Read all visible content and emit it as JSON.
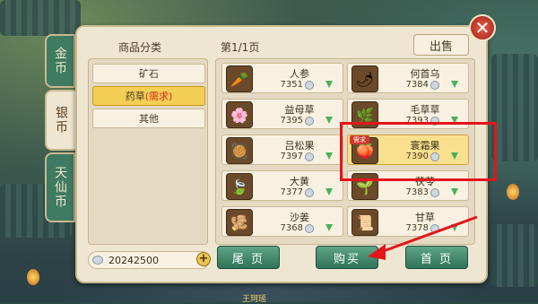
{
  "close_label": "✕",
  "vertical_tabs": [
    {
      "label": "金币",
      "active": false
    },
    {
      "label": "银币",
      "active": true
    },
    {
      "label": "天仙币",
      "active": false
    }
  ],
  "header": {
    "category_title": "商品分类",
    "page_label": "第1/1页",
    "sell_label": "出售"
  },
  "categories": [
    {
      "label": "矿石",
      "req": "",
      "selected": false
    },
    {
      "label": "药草",
      "req": "(需求)",
      "selected": true
    },
    {
      "label": "其他",
      "req": "",
      "selected": false
    }
  ],
  "items": [
    {
      "name": "人参",
      "price": "7351",
      "icon": "ginseng-icon",
      "glyph": "🥕",
      "tag": "",
      "selected": false
    },
    {
      "name": "何首乌",
      "price": "7384",
      "icon": "fleeceflower-icon",
      "glyph": "🌶",
      "tag": "",
      "selected": false
    },
    {
      "name": "益母草",
      "price": "7395",
      "icon": "motherwort-icon",
      "glyph": "🌸",
      "tag": "",
      "selected": false
    },
    {
      "name": "毛草草",
      "price": "7393",
      "icon": "grass-icon",
      "glyph": "🌿",
      "tag": "",
      "selected": false
    },
    {
      "name": "吕松果",
      "price": "7397",
      "icon": "pine-nut-icon",
      "glyph": "🥘",
      "tag": "",
      "selected": false
    },
    {
      "name": "寰霜果",
      "price": "7390",
      "icon": "frost-fruit-icon",
      "glyph": "🍑",
      "tag": "需求",
      "selected": true
    },
    {
      "name": "大黄",
      "price": "7377",
      "icon": "rhubarb-icon",
      "glyph": "🍃",
      "tag": "",
      "selected": false
    },
    {
      "name": "茯苓",
      "price": "7383",
      "icon": "poria-icon",
      "glyph": "🌱",
      "tag": "",
      "selected": false
    },
    {
      "name": "沙姜",
      "price": "7368",
      "icon": "ginger-icon",
      "glyph": "🫚",
      "tag": "",
      "selected": false
    },
    {
      "name": "甘草",
      "price": "7378",
      "icon": "licorice-icon",
      "glyph": "📜",
      "tag": "",
      "selected": false
    }
  ],
  "money": {
    "value": "20242500",
    "plus": "+"
  },
  "buttons": {
    "last_page": "尾 页",
    "buy": "购买",
    "first_page": "首 页"
  },
  "footer_text": "王珂瑶",
  "colors": {
    "highlight": "#e4151a",
    "button_green": "#3f8a6c"
  }
}
